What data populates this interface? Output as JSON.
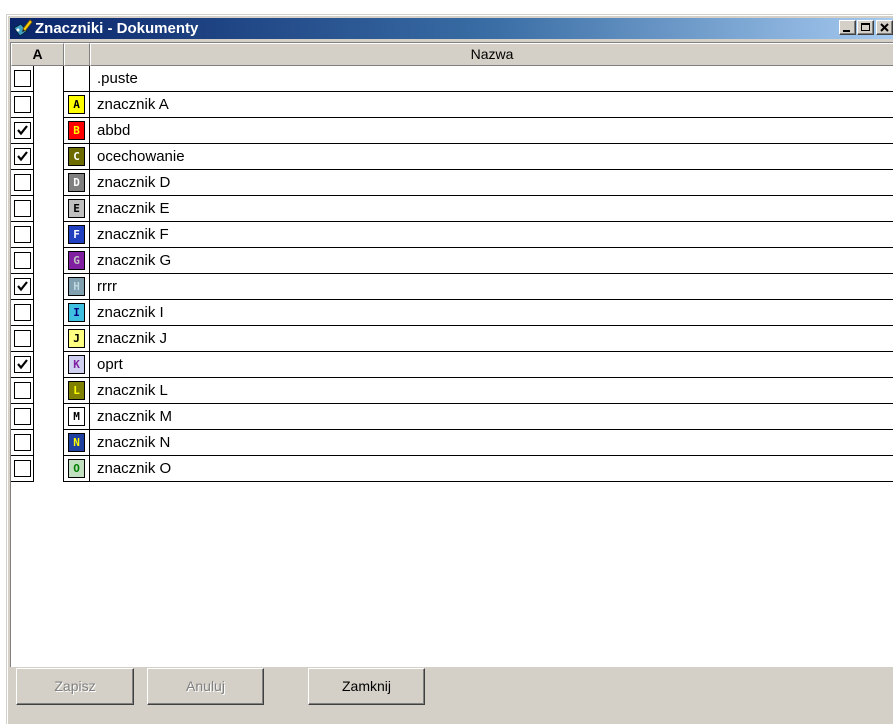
{
  "window": {
    "title": "Znaczniki - Dokumenty"
  },
  "grid": {
    "columns": {
      "active": "A",
      "icon": "",
      "name": "Nazwa"
    },
    "rows": [
      {
        "checked": false,
        "marker": "",
        "bg": "",
        "fg": "",
        "name": ".puste"
      },
      {
        "checked": false,
        "marker": "A",
        "bg": "#ffff00",
        "fg": "#000000",
        "name": "znacznik A"
      },
      {
        "checked": true,
        "marker": "B",
        "bg": "#ff0000",
        "fg": "#ffff00",
        "name": "abbd"
      },
      {
        "checked": true,
        "marker": "C",
        "bg": "#6b6b00",
        "fg": "#ffffff",
        "name": "ocechowanie"
      },
      {
        "checked": false,
        "marker": "D",
        "bg": "#808080",
        "fg": "#ffffff",
        "name": "znacznik D"
      },
      {
        "checked": false,
        "marker": "E",
        "bg": "#c0c0c0",
        "fg": "#000000",
        "name": "znacznik E"
      },
      {
        "checked": false,
        "marker": "F",
        "bg": "#2040c0",
        "fg": "#ffffff",
        "name": "znacznik F"
      },
      {
        "checked": false,
        "marker": "G",
        "bg": "#8020a0",
        "fg": "#c0c0c0",
        "name": "znacznik G"
      },
      {
        "checked": true,
        "marker": "H",
        "bg": "#80a0b0",
        "fg": "#c0d8e0",
        "name": "rrrr"
      },
      {
        "checked": false,
        "marker": "I",
        "bg": "#40c0e0",
        "fg": "#000080",
        "name": "znacznik I"
      },
      {
        "checked": false,
        "marker": "J",
        "bg": "#ffff80",
        "fg": "#000000",
        "name": "znacznik J"
      },
      {
        "checked": true,
        "marker": "K",
        "bg": "#d0d0f0",
        "fg": "#8020a0",
        "name": "oprt"
      },
      {
        "checked": false,
        "marker": "L",
        "bg": "#808000",
        "fg": "#ffff00",
        "name": "znacznik L"
      },
      {
        "checked": false,
        "marker": "M",
        "bg": "#ffffff",
        "fg": "#000000",
        "name": "znacznik M"
      },
      {
        "checked": false,
        "marker": "N",
        "bg": "#2040a0",
        "fg": "#ffff00",
        "name": "znacznik N"
      },
      {
        "checked": false,
        "marker": "O",
        "bg": "#c0e0c0",
        "fg": "#008000",
        "name": "znacznik O"
      }
    ]
  },
  "buttons": {
    "save": {
      "label": "Zapisz",
      "enabled": false
    },
    "cancel": {
      "label": "Anuluj",
      "enabled": false
    },
    "close": {
      "label": "Zamknij",
      "enabled": true
    }
  }
}
